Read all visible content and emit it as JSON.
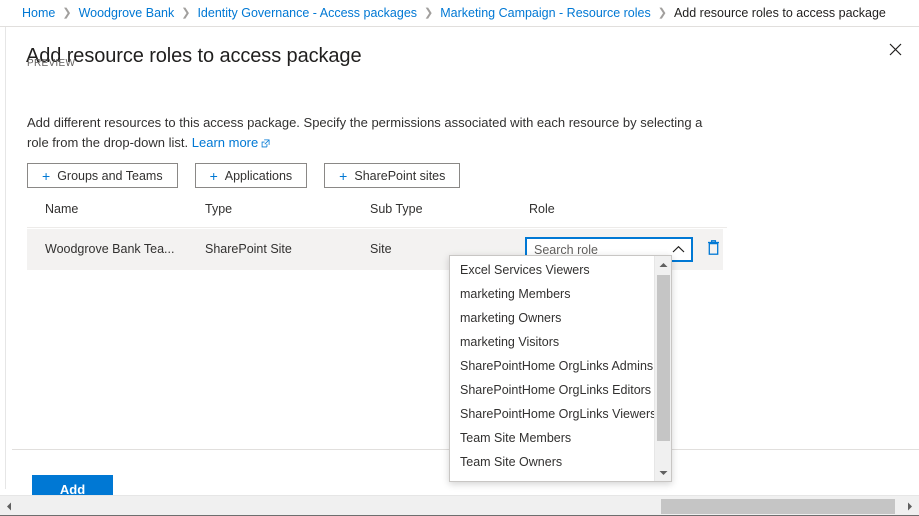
{
  "breadcrumb": {
    "items": [
      {
        "label": "Home",
        "current": false
      },
      {
        "label": "Woodgrove Bank",
        "current": false
      },
      {
        "label": "Identity Governance - Access packages",
        "current": false
      },
      {
        "label": "Marketing Campaign - Resource roles",
        "current": false
      },
      {
        "label": "Add resource roles to access package",
        "current": true
      }
    ],
    "separator": "❯"
  },
  "blade": {
    "title": "Add resource roles to access package",
    "preview_badge": "PREVIEW",
    "close_icon": "close-icon",
    "description_part1": "Add different resources to this access package. Specify the permissions associated with each resource by selecting a role from the drop-down list.",
    "learn_more_label": "Learn more",
    "learn_more_icon": "external-link-icon"
  },
  "commands": [
    {
      "label": "Groups and Teams",
      "icon": "plus-icon"
    },
    {
      "label": "Applications",
      "icon": "plus-icon"
    },
    {
      "label": "SharePoint sites",
      "icon": "plus-icon"
    }
  ],
  "table": {
    "columns": {
      "name": "Name",
      "type": "Type",
      "sub_type": "Sub Type",
      "role": "Role"
    },
    "rows": [
      {
        "name": "Woodgrove Bank Tea...",
        "type": "SharePoint Site",
        "sub_type": "Site",
        "role_placeholder": "Search role",
        "role_value": "",
        "chevron_icon": "chevron-up-icon",
        "delete_icon": "trash-icon"
      }
    ]
  },
  "role_dropdown": {
    "open": true,
    "options": [
      "Excel Services Viewers",
      "marketing Members",
      "marketing Owners",
      "marketing Visitors",
      "SharePointHome OrgLinks Admins",
      "SharePointHome OrgLinks Editors",
      "SharePointHome OrgLinks Viewers",
      "Team Site Members",
      "Team Site Owners"
    ],
    "scroll_up_icon": "scroll-up-arrow-icon",
    "scroll_down_icon": "scroll-down-arrow-icon"
  },
  "footer": {
    "add_label": "Add"
  },
  "window_scrollbar": {
    "left_arrow_icon": "scroll-left-arrow-icon",
    "right_arrow_icon": "scroll-right-arrow-icon"
  },
  "colors": {
    "accent": "#0078d4",
    "link": "#0078d4",
    "text": "#323130",
    "row_background": "#f3f2f1",
    "border": "#e1dfdd"
  }
}
